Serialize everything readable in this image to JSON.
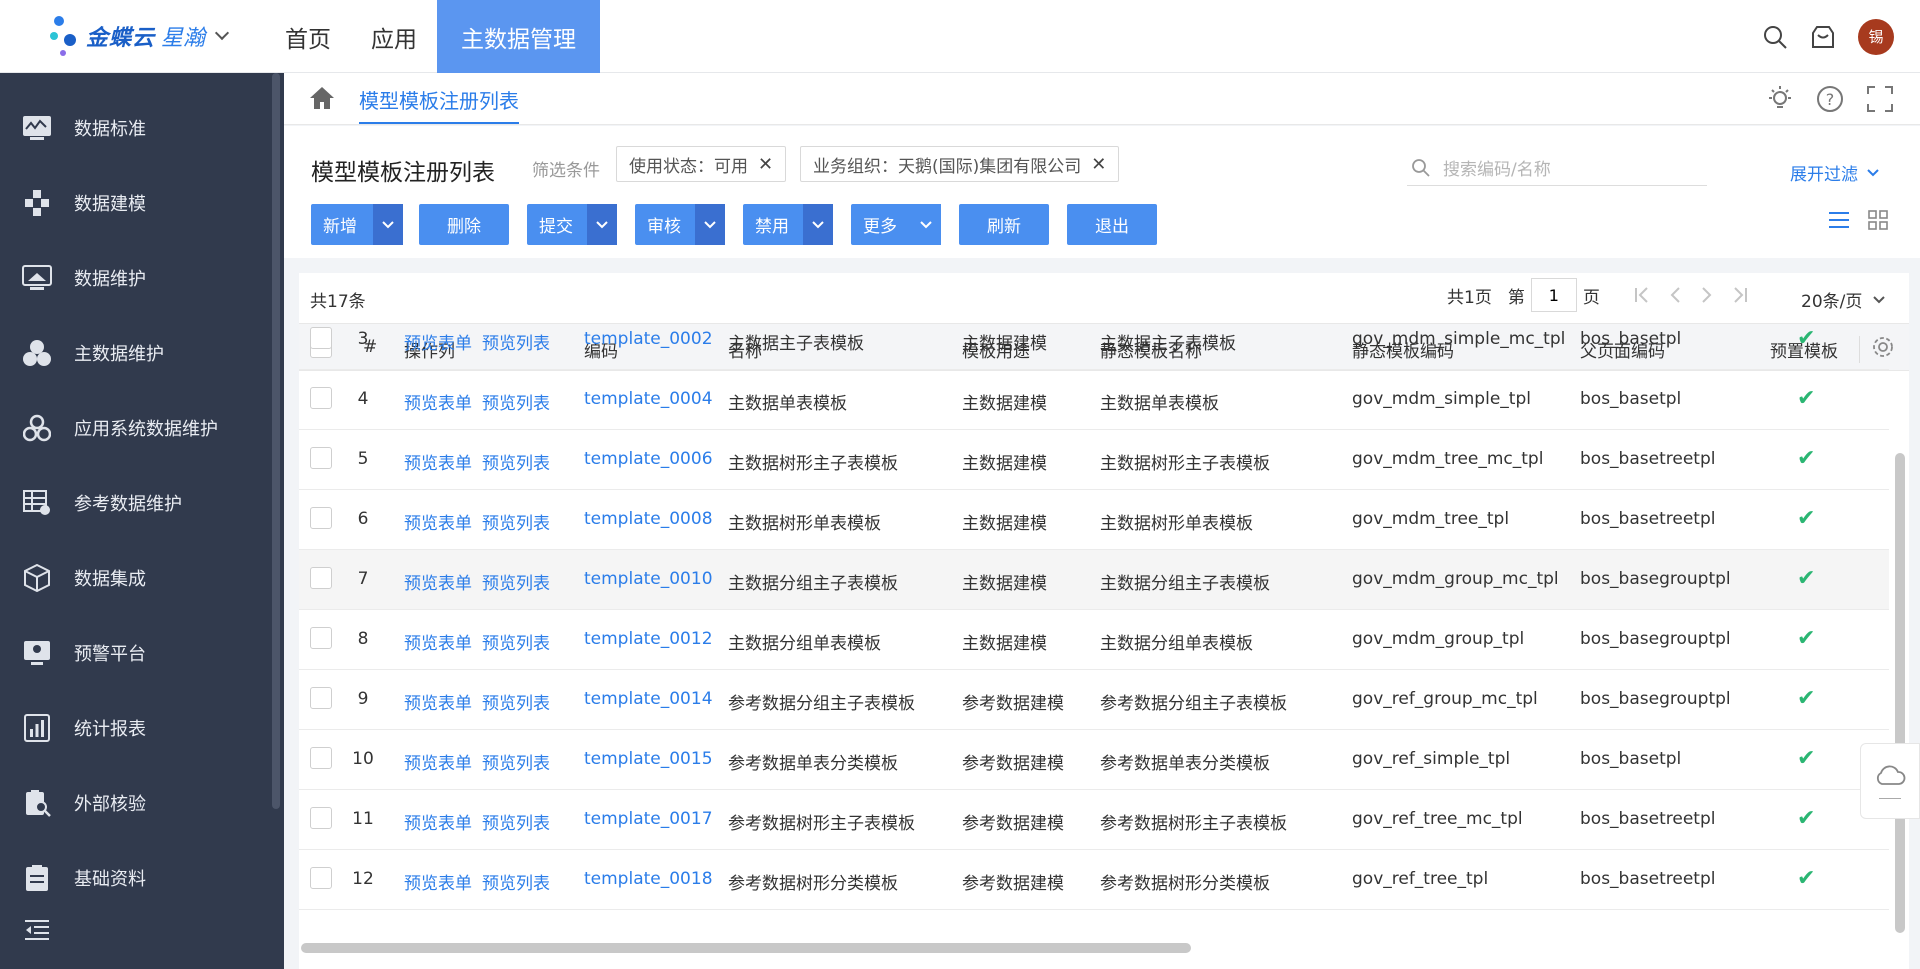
{
  "brand": {
    "name": "金蝶云",
    "product": "星瀚"
  },
  "topnav": {
    "items": [
      {
        "label": "首页",
        "active": false
      },
      {
        "label": "应用",
        "active": false
      },
      {
        "label": "主数据管理",
        "active": true
      }
    ],
    "user_avatar": "锡"
  },
  "sidebar": {
    "items": [
      {
        "label": "数据标准",
        "icon": "data-standard-icon"
      },
      {
        "label": "数据建模",
        "icon": "data-model-icon"
      },
      {
        "label": "数据维护",
        "icon": "data-maintain-icon"
      },
      {
        "label": "主数据维护",
        "icon": "master-data-icon"
      },
      {
        "label": "应用系统数据维护",
        "icon": "app-system-icon"
      },
      {
        "label": "参考数据维护",
        "icon": "reference-data-icon"
      },
      {
        "label": "数据集成",
        "icon": "integration-icon"
      },
      {
        "label": "预警平台",
        "icon": "alert-platform-icon"
      },
      {
        "label": "统计报表",
        "icon": "report-icon"
      },
      {
        "label": "外部核验",
        "icon": "verify-icon"
      },
      {
        "label": "基础资料",
        "icon": "basic-data-icon"
      }
    ]
  },
  "breadcrumb": {
    "current": "模型模板注册列表"
  },
  "header": {
    "title": "模型模板注册列表",
    "filter_label": "筛选条件",
    "filters": [
      "使用状态：可用",
      "业务组织：天鹅(国际)集团有限公司"
    ],
    "search_placeholder": "搜索编码/名称",
    "expand_filter": "展开过滤"
  },
  "toolbar": {
    "buttons": [
      {
        "label": "新增",
        "dropdown": true
      },
      {
        "label": "删除",
        "dropdown": false
      },
      {
        "label": "提交",
        "dropdown": true
      },
      {
        "label": "审核",
        "dropdown": true
      },
      {
        "label": "禁用",
        "dropdown": true
      },
      {
        "label": "更多",
        "dropdown": true
      },
      {
        "label": "刷新",
        "dropdown": false
      },
      {
        "label": "退出",
        "dropdown": false
      }
    ]
  },
  "table": {
    "total": "共17条",
    "pager": {
      "total_pages": "共1页",
      "page_prefix": "第",
      "page": "1",
      "page_suffix": "页",
      "page_size": "20条/页"
    },
    "columns": [
      "#",
      "操作列",
      "编码",
      "名称",
      "模板用途",
      "静态模板名称",
      "静态模板编码",
      "父页面编码",
      "预置模板"
    ],
    "action_labels": [
      "预览表单",
      "预览列表"
    ],
    "rows": [
      {
        "no": "3",
        "code": "template_0002",
        "name": "主数据主子表模板",
        "usage": "主数据建模",
        "static_name": "主数据主子表模板",
        "static_code": "gov_mdm_simple_mc_tpl",
        "parent": "bos_basetpl",
        "preset": "✔"
      },
      {
        "no": "4",
        "code": "template_0004",
        "name": "主数据单表模板",
        "usage": "主数据建模",
        "static_name": "主数据单表模板",
        "static_code": "gov_mdm_simple_tpl",
        "parent": "bos_basetpl",
        "preset": "✔"
      },
      {
        "no": "5",
        "code": "template_0006",
        "name": "主数据树形主子表模板",
        "usage": "主数据建模",
        "static_name": "主数据树形主子表模板",
        "static_code": "gov_mdm_tree_mc_tpl",
        "parent": "bos_basetreetpl",
        "preset": "✔"
      },
      {
        "no": "6",
        "code": "template_0008",
        "name": "主数据树形单表模板",
        "usage": "主数据建模",
        "static_name": "主数据树形单表模板",
        "static_code": "gov_mdm_tree_tpl",
        "parent": "bos_basetreetpl",
        "preset": "✔"
      },
      {
        "no": "7",
        "code": "template_0010",
        "name": "主数据分组主子表模板",
        "usage": "主数据建模",
        "static_name": "主数据分组主子表模板",
        "static_code": "gov_mdm_group_mc_tpl",
        "parent": "bos_basegrouptpl",
        "preset": "✔"
      },
      {
        "no": "8",
        "code": "template_0012",
        "name": "主数据分组单表模板",
        "usage": "主数据建模",
        "static_name": "主数据分组单表模板",
        "static_code": "gov_mdm_group_tpl",
        "parent": "bos_basegrouptpl",
        "preset": "✔"
      },
      {
        "no": "9",
        "code": "template_0014",
        "name": "参考数据分组主子表模板",
        "usage": "参考数据建模",
        "static_name": "参考数据分组主子表模板",
        "static_code": "gov_ref_group_mc_tpl",
        "parent": "bos_basegrouptpl",
        "preset": "✔"
      },
      {
        "no": "10",
        "code": "template_0015",
        "name": "参考数据单表分类模板",
        "usage": "参考数据建模",
        "static_name": "参考数据单表分类模板",
        "static_code": "gov_ref_simple_tpl",
        "parent": "bos_basetpl",
        "preset": "✔"
      },
      {
        "no": "11",
        "code": "template_0017",
        "name": "参考数据树形主子表模板",
        "usage": "参考数据建模",
        "static_name": "参考数据树形主子表模板",
        "static_code": "gov_ref_tree_mc_tpl",
        "parent": "bos_basetreetpl",
        "preset": "✔"
      },
      {
        "no": "12",
        "code": "template_0018",
        "name": "参考数据树形分类模板",
        "usage": "参考数据建模",
        "static_name": "参考数据树形分类模板",
        "static_code": "gov_ref_tree_tpl",
        "parent": "bos_basetreetpl",
        "preset": "✔"
      }
    ]
  },
  "colors": {
    "accent": "#2b7de9",
    "button": "#4a8ff0",
    "sidebar": "#313a4d",
    "check": "#2bb673"
  }
}
